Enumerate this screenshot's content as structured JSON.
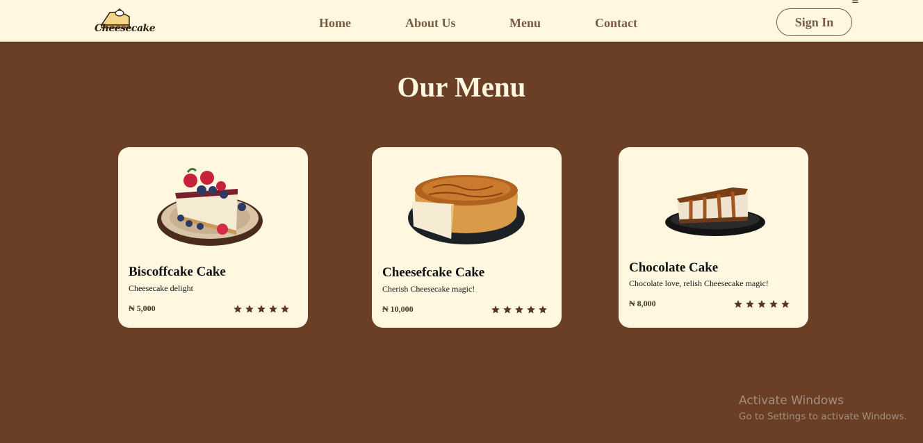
{
  "nav": {
    "logo_text": "Cheesecake",
    "links": [
      "Home",
      "About Us",
      "Menu",
      "Contact"
    ],
    "menu_glyph": "≡",
    "signin_label": "Sign In"
  },
  "menu": {
    "title": "Our Menu",
    "currency": "₦",
    "cards": [
      {
        "name": "Biscoffcake Cake",
        "desc": "Cheesecake delight",
        "price": "₦ 5,000",
        "rating": 5,
        "image": "berry-cheesecake-slice"
      },
      {
        "name": "Cheesefcake Cake",
        "desc": "Cherish Cheesecake magic!",
        "price": "₦ 10,000",
        "rating": 5,
        "image": "whole-cheesecake-tart"
      },
      {
        "name": "Chocolate Cake",
        "desc": "Chocolate love, relish Cheesecake magic!",
        "price": "₦ 8,000",
        "rating": 5,
        "image": "caramel-cheesecake-slice"
      }
    ]
  },
  "watermark": {
    "title": "Activate Windows",
    "subtitle": "Go to Settings to activate Windows."
  },
  "colors": {
    "background": "#6b3f26",
    "cream": "#fff7e0",
    "nav_text": "#7d5a44",
    "star": "#5a3520"
  }
}
